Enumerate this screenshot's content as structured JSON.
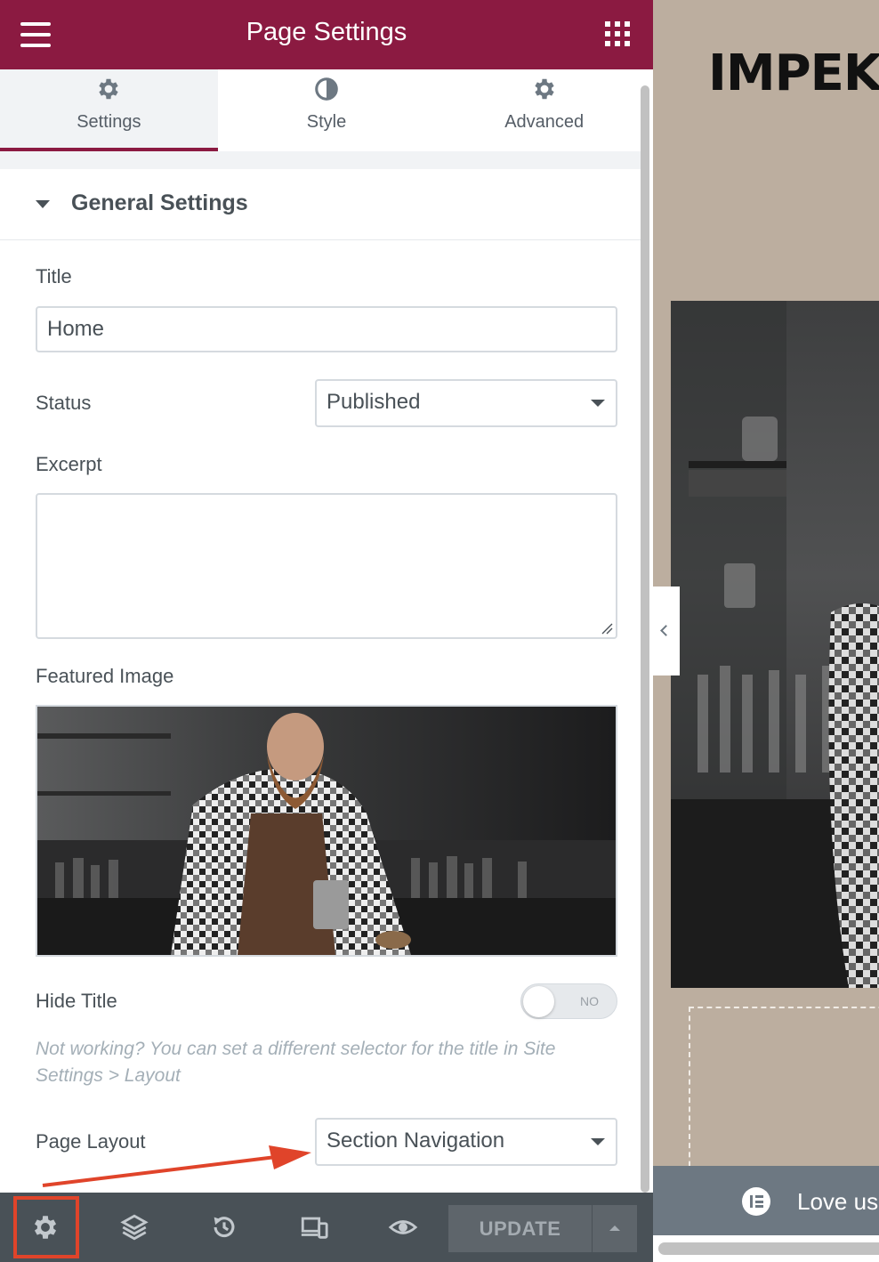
{
  "header": {
    "title": "Page Settings",
    "menu_icon": "hamburger-icon",
    "apps_icon": "grid-icon"
  },
  "tabs": [
    {
      "label": "Settings",
      "icon": "gear-icon",
      "active": true
    },
    {
      "label": "Style",
      "icon": "half-circle-icon",
      "active": false
    },
    {
      "label": "Advanced",
      "icon": "gear-icon",
      "active": false
    }
  ],
  "section": {
    "title": "General Settings",
    "fields": {
      "title_label": "Title",
      "title_value": "Home",
      "status_label": "Status",
      "status_value": "Published",
      "excerpt_label": "Excerpt",
      "excerpt_value": "",
      "featured_label": "Featured Image",
      "hide_title_label": "Hide Title",
      "hide_title_toggle": "NO",
      "hint": "Not working? You can set a different selector for the title in Site Settings > Layout",
      "page_layout_label": "Page Layout",
      "page_layout_value": "Section Navigation"
    }
  },
  "footer": {
    "icons": [
      "gear-icon",
      "layers-icon",
      "history-icon",
      "responsive-icon",
      "eye-icon"
    ],
    "update_label": "UPDATE"
  },
  "preview": {
    "logo_text": "IMPEKA",
    "banner_text": "Love usi"
  },
  "colors": {
    "brand": "#8b1a41",
    "footer_bg": "#495157",
    "preview_bg": "#bcae9f",
    "highlight": "#e0442a"
  }
}
